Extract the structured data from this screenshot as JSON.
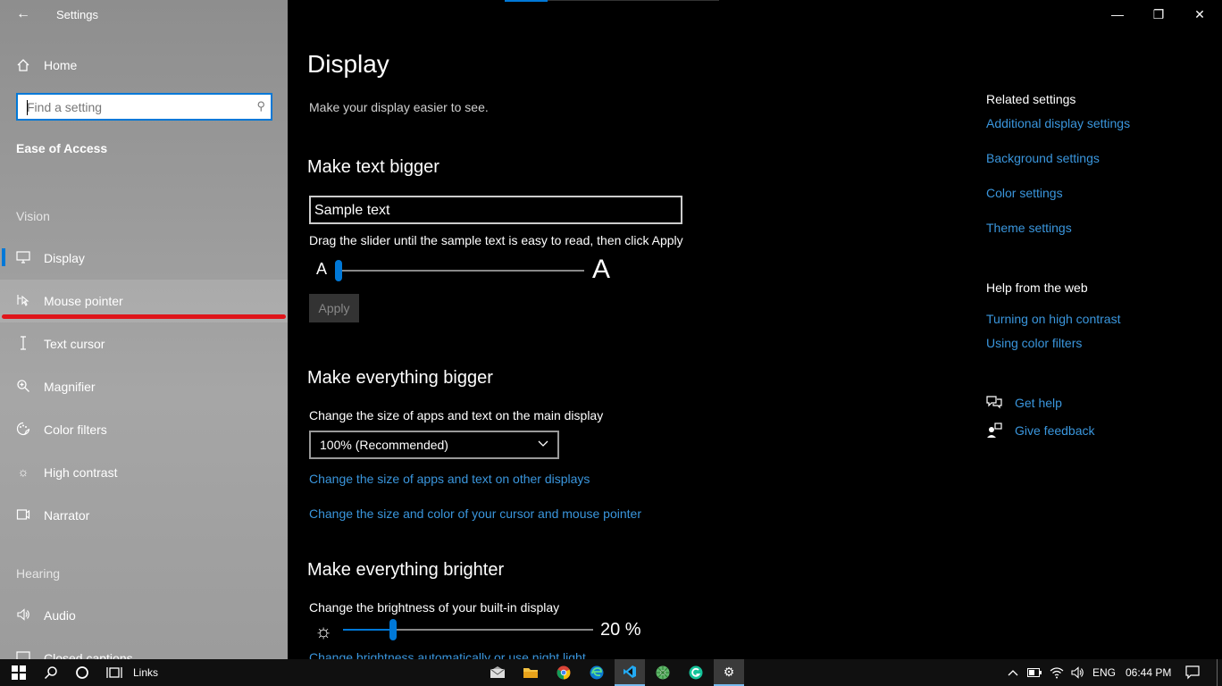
{
  "window": {
    "title": "Settings",
    "back_icon": "back-arrow-icon",
    "minimize": "—",
    "maximize": "❐",
    "close": "✕"
  },
  "sidebar": {
    "home_label": "Home",
    "search_placeholder": "Find a setting",
    "section_title": "Ease of Access",
    "groups": {
      "vision": "Vision",
      "hearing": "Hearing"
    },
    "items": [
      {
        "label": "Display",
        "icon": "monitor-icon",
        "selected": true
      },
      {
        "label": "Mouse pointer",
        "icon": "mouse-pointer-icon"
      },
      {
        "label": "Text cursor",
        "icon": "text-cursor-icon"
      },
      {
        "label": "Magnifier",
        "icon": "magnifier-icon"
      },
      {
        "label": "Color filters",
        "icon": "color-filters-icon"
      },
      {
        "label": "High contrast",
        "icon": "high-contrast-icon"
      },
      {
        "label": "Narrator",
        "icon": "narrator-icon"
      },
      {
        "label": "Audio",
        "icon": "audio-icon"
      },
      {
        "label": "Closed captions",
        "icon": "closed-captions-icon"
      }
    ]
  },
  "main": {
    "title": "Display",
    "subtitle": "Make your display easier to see.",
    "text_bigger": {
      "heading": "Make text bigger",
      "sample": "Sample text",
      "instruction": "Drag the slider until the sample text is easy to read, then click Apply",
      "small_a": "A",
      "big_a": "A",
      "slider_value": 0.0,
      "apply_label": "Apply"
    },
    "everything_bigger": {
      "heading": "Make everything bigger",
      "label": "Change the size of apps and text on the main display",
      "dropdown_value": "100% (Recommended)",
      "link1": "Change the size of apps and text on other displays",
      "link2": "Change the size and color of your cursor and mouse pointer"
    },
    "brighter": {
      "heading": "Make everything brighter",
      "label": "Change the brightness of your built-in display",
      "value": 20,
      "value_text": "20 %",
      "link": "Change brightness automatically or use night light"
    }
  },
  "related": {
    "heading": "Related settings",
    "links": [
      "Additional display settings",
      "Background settings",
      "Color settings",
      "Theme settings"
    ],
    "web_heading": "Help from the web",
    "web_links": [
      "Turning on high contrast",
      "Using color filters"
    ],
    "get_help": "Get help",
    "give_feedback": "Give feedback"
  },
  "taskbar": {
    "links_label": "Links",
    "language": "ENG",
    "time": "06:44 PM",
    "accent_color": "#0078d7"
  }
}
